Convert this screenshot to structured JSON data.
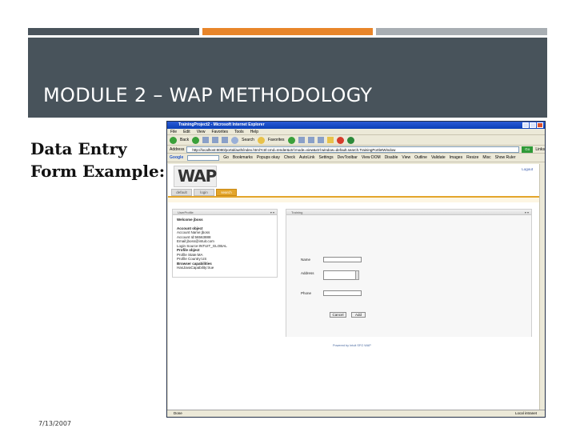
{
  "slide": {
    "title": "MODULE 2 – WAP METHODOLOGY",
    "subtitle": "Data Entry\nForm Example:",
    "date": "7/13/2007"
  },
  "browser": {
    "window_title": "TrainingProject2 - Microsoft Internet Explorer",
    "menu": [
      "File",
      "Edit",
      "View",
      "Favorites",
      "Tools",
      "Help"
    ],
    "toolbar": {
      "back": "Back",
      "search": "Search",
      "favorites": "Favorites"
    },
    "address_label": "Address",
    "address_url": "http://localhost:8080/portal/auth/index.html?ctrl:cmd=render&ctrl:mode=view&ctrl:window=default.search.TrainingPortletWindow",
    "go": "Go",
    "links": "Links",
    "googlebar": [
      "Google",
      "Go",
      "Bookmarks",
      "Popups okay",
      "Check",
      "AutoLink",
      "Settings",
      "DevToolbar",
      "View DOM",
      "Disable",
      "View",
      "Outline",
      "Validate",
      "Images",
      "Resize",
      "Misc",
      "Show Ruler"
    ],
    "status_left": "Done",
    "status_zone": "Local intranet"
  },
  "page": {
    "logo": "WAP",
    "logout": "Logout",
    "tabs": [
      "default",
      "login",
      "search"
    ],
    "profile_title": "UserProfile",
    "profile": {
      "welcome": "Welcome jboss",
      "account_heading": "Account object",
      "account_name": "Account Name:jboss",
      "account_id": "Account Id:56563888",
      "email": "Email:jboss@intuit.com",
      "login_source": "Login Source:INTUIT_GLOBAL",
      "profile_heading": "Profile object",
      "profile_state": "Profile State:MA",
      "profile_country": "Profile Country:US",
      "browser_heading": "Browser capabilities",
      "has_java": "HasJavaCapability:true"
    },
    "form_title": "Training",
    "form": {
      "name_label": "Name",
      "address_label": "Address",
      "phone_label": "Phone",
      "cancel": "Cancel",
      "add": "Add"
    },
    "powered_by": "Powered by Intuit SFG WAP"
  }
}
